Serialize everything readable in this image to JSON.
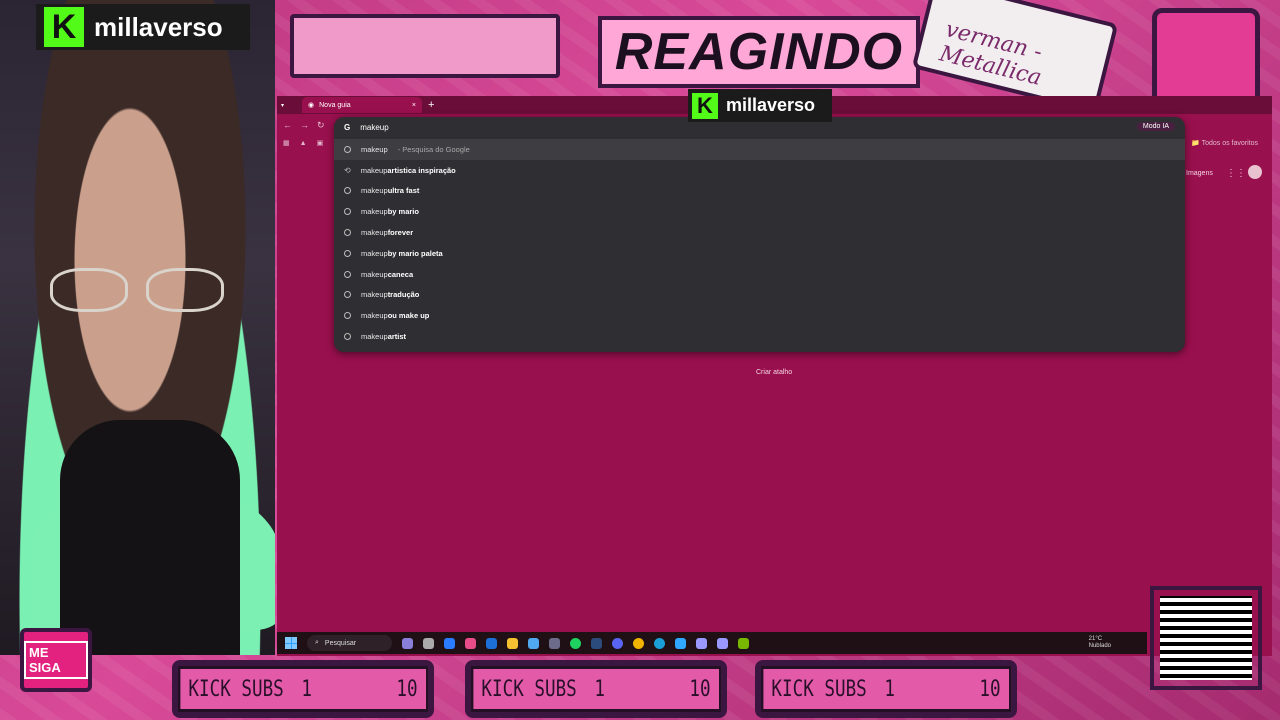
{
  "overlay": {
    "channel_name": "millaverso",
    "title": "REAGINDO",
    "tape_text": "verman - Metallica",
    "me_siga": "ME SIGA",
    "kick_goals": [
      {
        "label": "KICK SUBS",
        "current": "1",
        "goal": "10"
      },
      {
        "label": "KICK SUBS",
        "current": "1",
        "goal": "10"
      },
      {
        "label": "KICK SUBS",
        "current": "1",
        "goal": "10"
      }
    ]
  },
  "browser": {
    "tab_title": "Nova guia",
    "close_tab": "×",
    "new_tab": "+",
    "all_bookmarks": "Todos os favoritos",
    "images_link": "Imagens",
    "create_shortcut": "Criar atalho"
  },
  "omnibox": {
    "query": "makeup",
    "google_mark": "G",
    "ai_mode": "Modo IA",
    "suggestions": [
      {
        "query": "makeup",
        "bold": "",
        "desc": " - Pesquisa do Google"
      },
      {
        "query": "makeup",
        "bold": " artistica inspiração",
        "desc": ""
      },
      {
        "query": "makeup",
        "bold": " ultra fast",
        "desc": ""
      },
      {
        "query": "makeup",
        "bold": " by mario",
        "desc": ""
      },
      {
        "query": "makeup",
        "bold": " forever",
        "desc": ""
      },
      {
        "query": "makeup",
        "bold": " by mario paleta",
        "desc": ""
      },
      {
        "query": "makeup",
        "bold": " caneca",
        "desc": ""
      },
      {
        "query": "makeup",
        "bold": " tradução",
        "desc": ""
      },
      {
        "query": "makeup",
        "bold": " ou make up",
        "desc": ""
      },
      {
        "query": "makeup",
        "bold": " artist",
        "desc": ""
      }
    ]
  },
  "taskbar": {
    "search_label": "Pesquisar",
    "temperature": "21°C",
    "weather": "Nublado"
  },
  "colors": {
    "kick_green": "#53fc18",
    "browser_bg": "#99104e",
    "overlay_pink": "#e35aa8"
  }
}
